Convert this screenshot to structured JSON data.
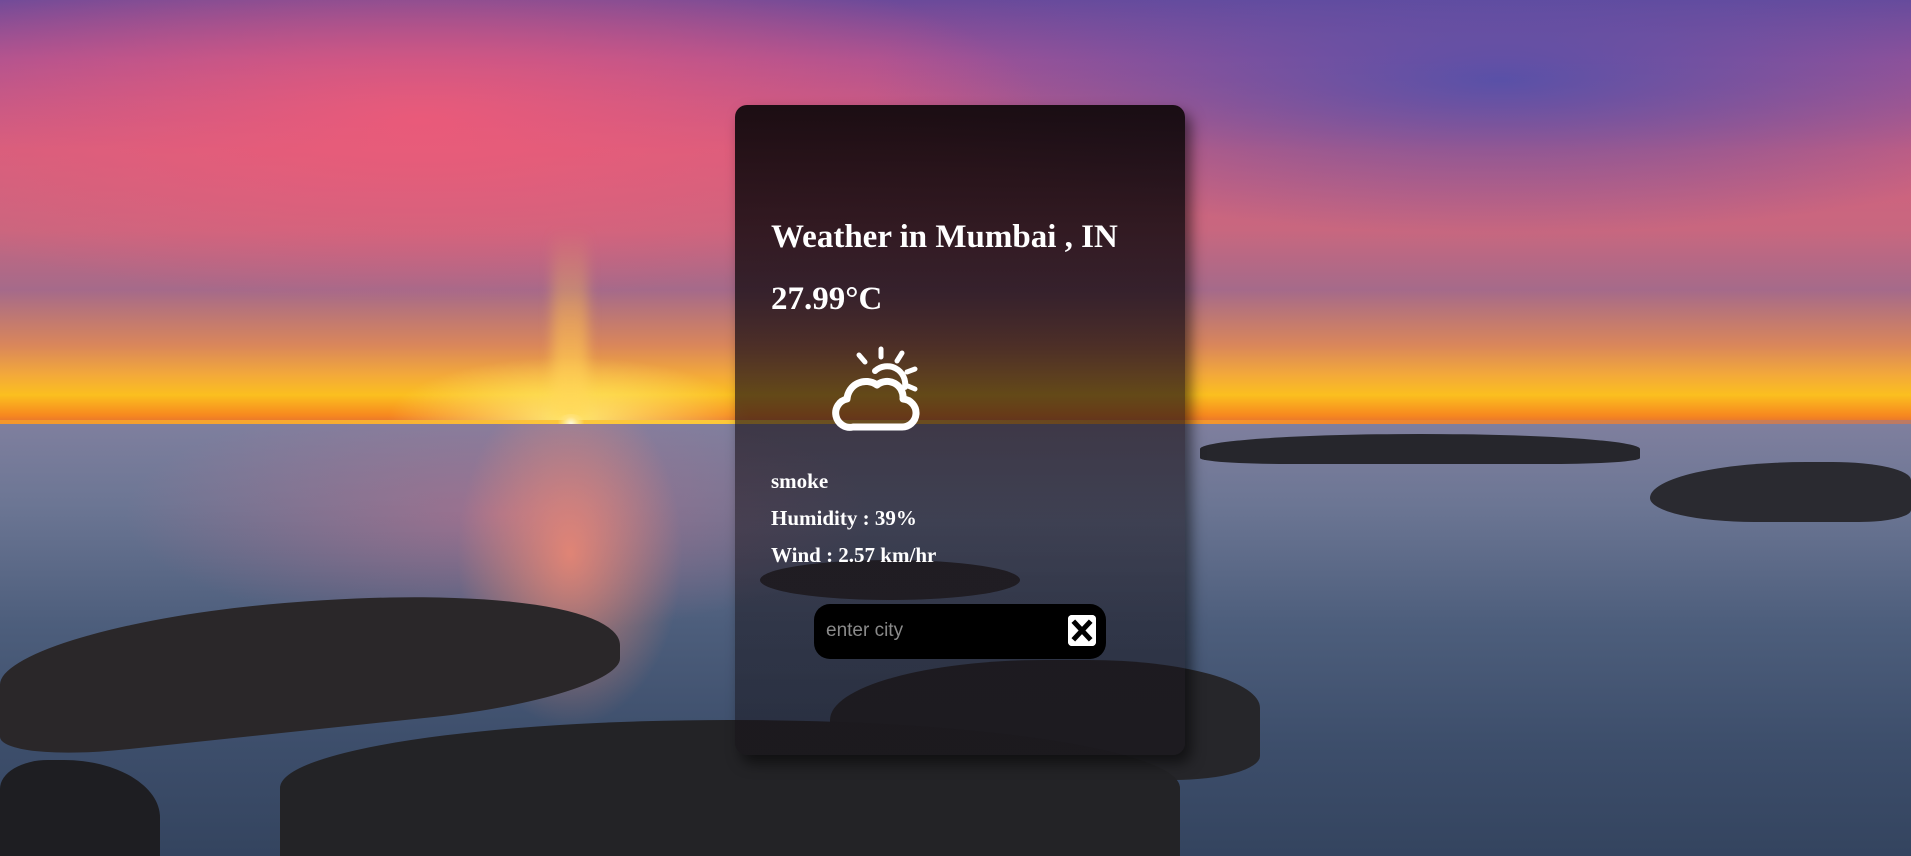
{
  "weather": {
    "title": "Weather in Mumbai , IN",
    "temperature": "27.99°C",
    "icon": "partly-cloudy-sun-icon",
    "description": "smoke",
    "humidity": "Humidity : 39%",
    "wind": "Wind : 2.57 km/hr"
  },
  "search": {
    "placeholder": "enter city",
    "value": "",
    "clear_icon": "close-icon"
  }
}
